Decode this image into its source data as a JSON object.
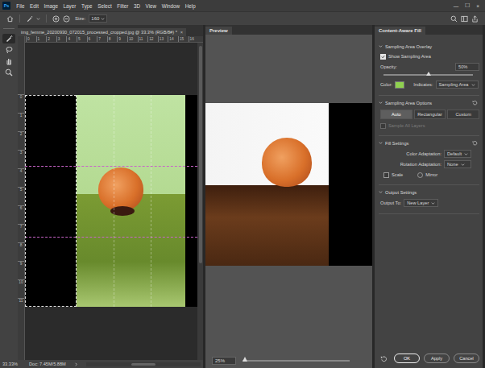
{
  "app": {
    "logo": "Ps",
    "window_controls": [
      "—",
      "☐",
      "×"
    ]
  },
  "menu": [
    "File",
    "Edit",
    "Image",
    "Layer",
    "Type",
    "Select",
    "Filter",
    "3D",
    "View",
    "Window",
    "Help"
  ],
  "options_bar": {
    "size_label": "Size:",
    "size_value": "160"
  },
  "tools": [
    {
      "kind": "brush",
      "selected": true
    },
    {
      "kind": "lasso",
      "selected": false
    },
    {
      "kind": "hand",
      "selected": false
    },
    {
      "kind": "zoom",
      "selected": false
    }
  ],
  "document": {
    "tab": "img_femme_20200930_072015_processed_cropped.jpg @ 33.3% (RGB/8#) *",
    "close": "×",
    "ruler_top": [
      "0",
      "1",
      "2",
      "3",
      "4",
      "5",
      "6",
      "7",
      "8",
      "9",
      "10",
      "11",
      "12",
      "13",
      "14",
      "15",
      "16"
    ],
    "ruler_left": [
      "0",
      "1",
      "2",
      "3",
      "4",
      "5",
      "6",
      "7",
      "8",
      "9",
      "10",
      "11"
    ]
  },
  "preview": {
    "title": "Preview",
    "zoom": "25%",
    "zoom_level": 0.02
  },
  "status_bar": {
    "zoom": "33.33%",
    "doc": "Doc: 7.45M/5.88M"
  },
  "panel": {
    "title": "Content-Aware Fill",
    "overlay": {
      "title": "Sampling Area Overlay",
      "expanded": true,
      "show_label": "Show Sampling Area",
      "show_checked": true,
      "opacity_label": "Opacity:",
      "opacity": "50%",
      "opacity_level": 0.5,
      "color_label": "Color:",
      "overlay_color": "#8fd14f",
      "indicates_label": "Indicates:",
      "indicates": "Sampling Area"
    },
    "sampling": {
      "title": "Sampling Area Options",
      "expanded": true,
      "modes": [
        {
          "label": "Auto",
          "selected": true
        },
        {
          "label": "Rectangular",
          "selected": false
        },
        {
          "label": "Custom",
          "selected": false
        }
      ],
      "all_layers_label": "Sample All Layers",
      "all_layers_checked": false,
      "all_layers_disabled": true
    },
    "fill": {
      "title": "Fill Settings",
      "expanded": true,
      "color_adaptation_label": "Color Adaptation:",
      "color_adaptation": "Default",
      "rotation_label": "Rotation Adaptation:",
      "rotation": "None",
      "options": [
        {
          "label": "Scale",
          "kind": "checkbox",
          "checked": false
        },
        {
          "label": "Mirror",
          "kind": "radio",
          "checked": false
        }
      ]
    },
    "output": {
      "title": "Output Settings",
      "expanded": true,
      "label": "Output To:",
      "value": "New Layer"
    },
    "buttons": [
      {
        "label": "OK",
        "primary": true
      },
      {
        "label": "Apply",
        "primary": false
      },
      {
        "label": "Cancel",
        "primary": false
      }
    ]
  }
}
